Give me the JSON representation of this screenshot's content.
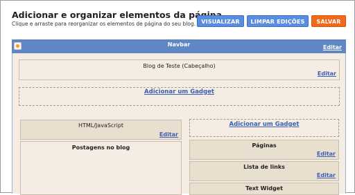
{
  "header": {
    "title": "Adicionar e organizar elementos da página",
    "subtitle": "Clique e arraste para reorganizar os elementos de página do seu blog."
  },
  "toolbar": {
    "preview_label": "VISUALIZAR",
    "clear_label": "LIMPAR EDIÇÕES",
    "save_label": "SALVAR"
  },
  "navbar": {
    "title": "Navbar",
    "edit_label": "Editar"
  },
  "layout": {
    "header_widget": {
      "title": "Blog de Teste (Cabeçalho)",
      "edit_label": "Editar"
    },
    "add_gadget_label": "Adicionar um Gadget",
    "main_column": [
      {
        "title": "HTML/JavaScript",
        "edit_label": "Editar"
      },
      {
        "title": "Postagens no blog"
      }
    ],
    "sidebar": {
      "add_gadget_label": "Adicionar um Gadget",
      "widgets": [
        {
          "title": "Páginas",
          "edit_label": "Editar"
        },
        {
          "title": "Lista de links",
          "edit_label": "Editar"
        },
        {
          "title": "Text Widget"
        }
      ]
    }
  },
  "colors": {
    "accent_blue": "#5a8de0",
    "save_orange": "#f06a1a",
    "navbar_blue": "#5e87c4",
    "canvas_bg": "#f5ede3",
    "widget_bg": "#e9dfcf",
    "link_blue": "#3a5fb5"
  }
}
